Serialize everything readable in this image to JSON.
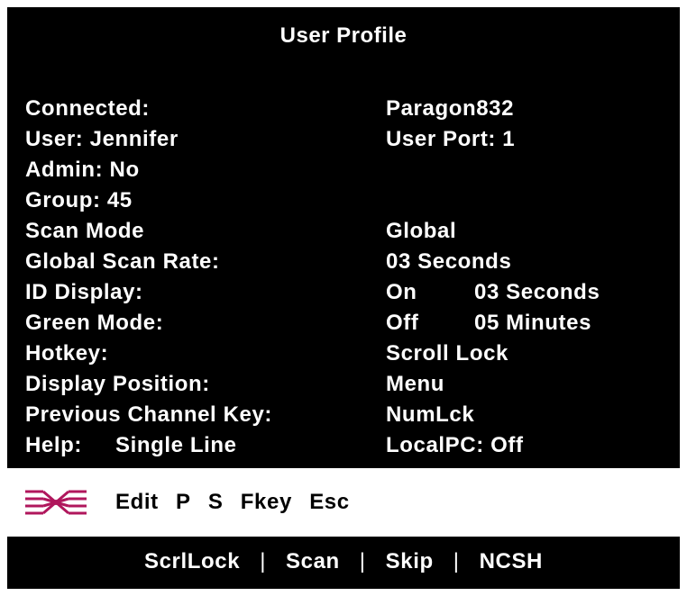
{
  "window": {
    "title": "User Profile"
  },
  "profile": {
    "connected_label": "Connected:",
    "connected_value": "Paragon832",
    "user_label": "User: Jennifer",
    "user_port": "User Port: 1",
    "admin": "Admin: No",
    "group": "Group: 45",
    "scan_mode_label": "Scan Mode",
    "scan_mode_value": "Global",
    "global_scan_rate_label": "Global Scan Rate:",
    "global_scan_rate_value": "03 Seconds",
    "id_display_label": "ID Display:",
    "id_display_state": "On",
    "id_display_time": "03 Seconds",
    "green_mode_label": "Green Mode:",
    "green_mode_state": "Off",
    "green_mode_time": "05 Minutes",
    "hotkey_label": "Hotkey:",
    "hotkey_value": "Scroll Lock",
    "display_position_label": "Display Position:",
    "display_position_value": "Menu",
    "prev_channel_label": "Previous Channel Key:",
    "prev_channel_value": "NumLck",
    "help_label": "Help:",
    "help_value": "Single Line",
    "localpc": "LocalPC: Off"
  },
  "command_bar": {
    "logo_icon": "raritan-logo-icon",
    "edit": "Edit",
    "p": "P",
    "s": "S",
    "fkey": "Fkey",
    "esc": "Esc",
    "logo_color": "#b0165c"
  },
  "status_bar": {
    "scrllock": "ScrlLock",
    "scan": "Scan",
    "skip": "Skip",
    "ncsh": "NCSH",
    "separator": "|"
  }
}
